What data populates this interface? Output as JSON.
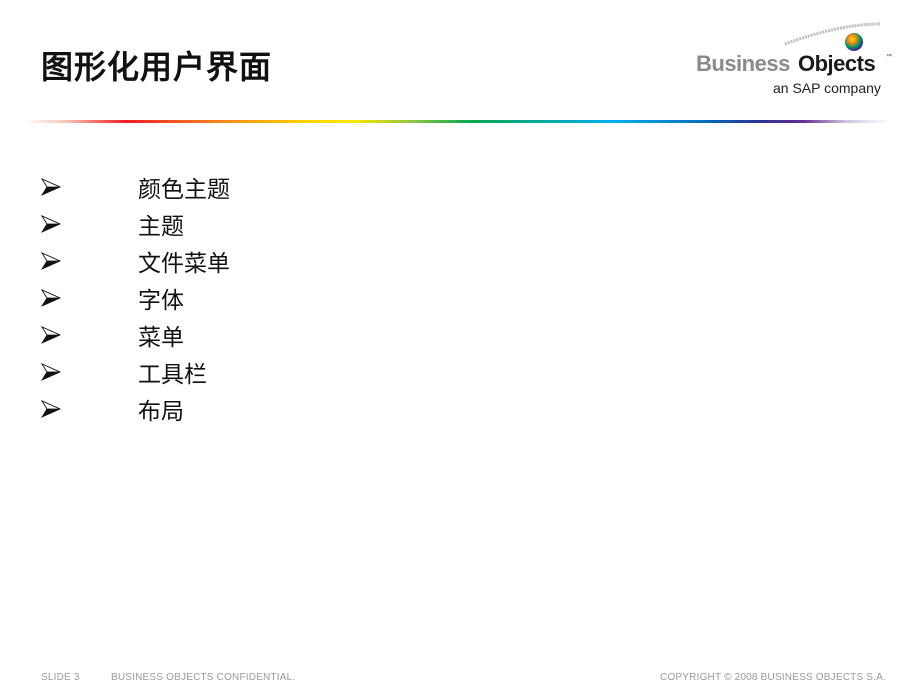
{
  "slide": {
    "title": "图形化用户界面",
    "bullets": [
      {
        "icon": "arrow-bullet-icon",
        "label": "颜色主题"
      },
      {
        "icon": "arrow-bullet-icon",
        "label": "主题"
      },
      {
        "icon": "arrow-bullet-icon",
        "label": "文件菜单"
      },
      {
        "icon": "arrow-bullet-icon",
        "label": "字体"
      },
      {
        "icon": "arrow-bullet-icon",
        "label": "菜单"
      },
      {
        "icon": "arrow-bullet-icon",
        "label": "工具栏"
      },
      {
        "icon": "arrow-bullet-icon",
        "label": "布局"
      }
    ]
  },
  "logo": {
    "brand_part1": "Business",
    "brand_part2": "Objects",
    "trademark": "™",
    "tagline": "an SAP company"
  },
  "footer": {
    "slide_number": "SLIDE 3",
    "confidential": "BUSINESS OBJECTS CONFIDENTIAL.",
    "copyright": "COPYRIGHT © 2008 BUSINESS OBJECTS S.A."
  },
  "colors": {
    "title": "#111111",
    "footer_text": "#9a9a9a",
    "logo_gray": "#8a8a8a",
    "logo_dark": "#1a1a1a"
  }
}
